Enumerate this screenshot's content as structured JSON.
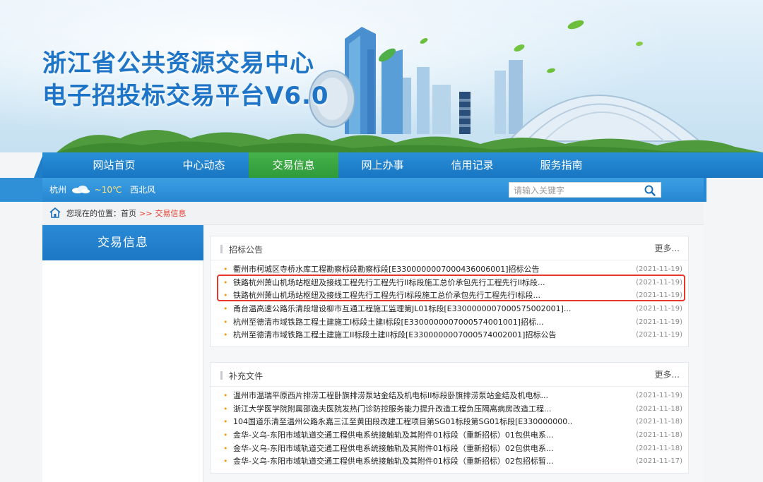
{
  "banner": {
    "title_line1": "浙江省公共资源交易中心",
    "title_line2": "电子招投标交易平台V6.0"
  },
  "nav": {
    "items": [
      {
        "label": "网站首页",
        "active": false
      },
      {
        "label": "中心动态",
        "active": false
      },
      {
        "label": "交易信息",
        "active": true
      },
      {
        "label": "网上办事",
        "active": false
      },
      {
        "label": "信用记录",
        "active": false
      },
      {
        "label": "服务指南",
        "active": false
      }
    ]
  },
  "weather": {
    "city": "杭州",
    "temp": "~10℃",
    "wind": "西北风"
  },
  "search": {
    "placeholder": "请输入关键字"
  },
  "breadcrumb": {
    "prefix": "您现在的位置：",
    "home": "首页",
    "sep": ">>",
    "current": "交易信息"
  },
  "sidebar": {
    "title": "交易信息"
  },
  "panels": {
    "bidding": {
      "title": "招标公告",
      "more": "更多...",
      "items": [
        {
          "title": "衢州市柯城区寺桥水库工程勘察标段勘察标段[E3300000007000436006001]招标公告",
          "date": "(2021-11-19)"
        },
        {
          "title": "铁路杭州萧山机场站枢纽及接线工程先行工程先行II标段施工总价承包先行工程先行II标段...",
          "date": "(2021-11-19)"
        },
        {
          "title": "铁路杭州萧山机场站枢纽及接线工程先行工程先行Ⅰ标段施工总价承包先行工程先行Ⅰ标段...",
          "date": "(2021-11-19)"
        },
        {
          "title": "甬台温高速公路乐清段增设柳市互通工程施工监理第JL01标段[E3300000007000575002001]...",
          "date": "(2021-11-19)"
        },
        {
          "title": "杭州至德清市域铁路工程土建施工Ⅰ标段土建Ⅰ标段[E3300000007000574001001]招标...",
          "date": "(2021-11-19)"
        },
        {
          "title": "杭州至德清市域铁路工程土建施工II标段土建II标段[E3300000007000574002001]招标公告",
          "date": "(2021-11-19)"
        }
      ]
    },
    "supplement": {
      "title": "补充文件",
      "more": "更多...",
      "items": [
        {
          "title": "温州市温瑞平原西片排涝工程卧旗排涝泵站金结及机电标II标段卧旗排涝泵站金结及机电标...",
          "date": "(2021-11-19)"
        },
        {
          "title": "浙江大学医学院附属邵逸夫医院发热门诊防控服务能力提升改造工程负压隔离病房改造工程...",
          "date": "(2021-11-18)"
        },
        {
          "title": "104国道乐清至温州公路永嘉三江至黄田段改建工程项目第SG01标段第SG01标段[E330000000...",
          "date": "(2021-11-18)"
        },
        {
          "title": "金华-义乌-东阳市域轨道交通工程供电系统接触轨及其附件01标段（重新招标）01包供电系...",
          "date": "(2021-11-18)"
        },
        {
          "title": "金华-义乌-东阳市域轨道交通工程供电系统接触轨及其附件01标段（重新招标）02包供电系...",
          "date": "(2021-11-18)"
        },
        {
          "title": "金华-义乌-东阳市域轨道交通工程供电系统接触轨及其附件01标段（重新招标）02包招标暂...",
          "date": "(2021-11-17)"
        }
      ]
    }
  },
  "colors": {
    "nav_blue": "#1e7ec9",
    "nav_active_green": "#2e9a3a",
    "highlight_red": "#e7362c",
    "bullet_orange": "#f39c1a",
    "breadcrumb_red": "#e23c2c"
  }
}
